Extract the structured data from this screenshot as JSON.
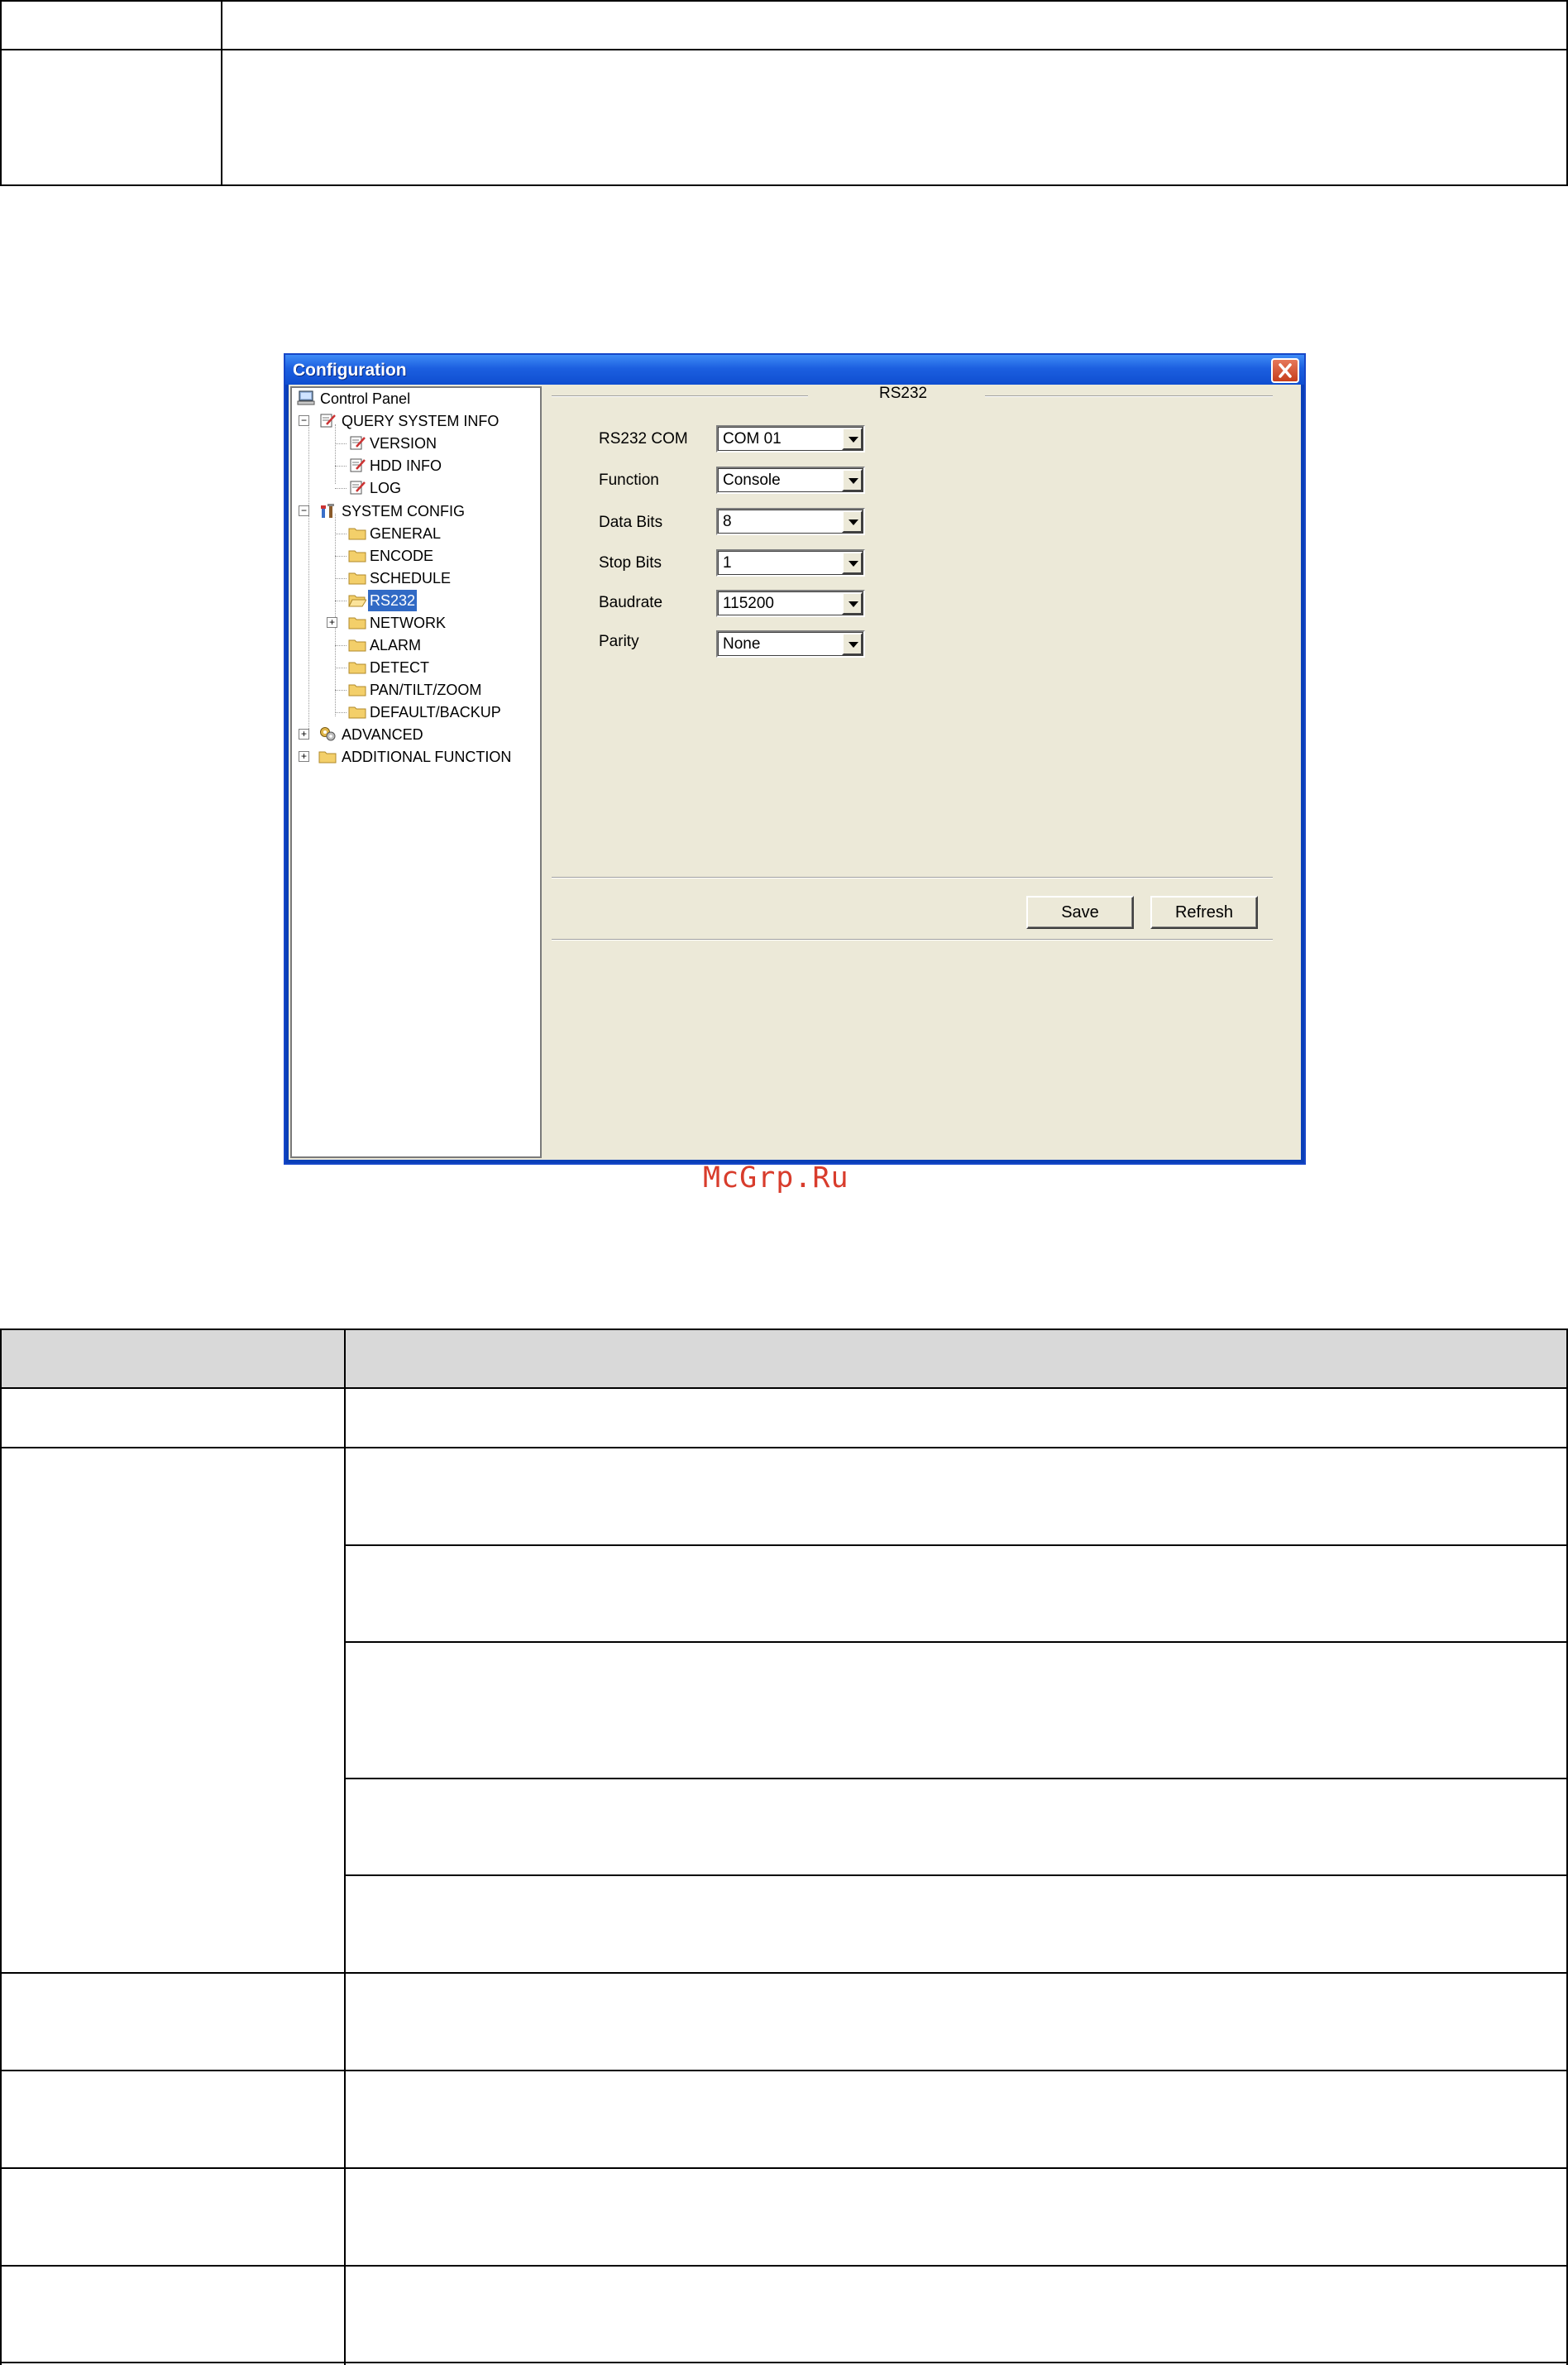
{
  "window": {
    "title": "Configuration",
    "close_icon": "close-icon"
  },
  "tree": {
    "root": {
      "label": "Control Panel",
      "icon": "computer-icon"
    },
    "items": [
      {
        "label": "QUERY SYSTEM INFO",
        "icon": "notepad-icon",
        "expander": "−"
      },
      {
        "label": "VERSION",
        "icon": "notepad-icon"
      },
      {
        "label": "HDD INFO",
        "icon": "notepad-icon"
      },
      {
        "label": "LOG",
        "icon": "notepad-icon"
      },
      {
        "label": "SYSTEM CONFIG",
        "icon": "tools-icon",
        "expander": "−"
      },
      {
        "label": "GENERAL",
        "icon": "folder-icon"
      },
      {
        "label": "ENCODE",
        "icon": "folder-icon"
      },
      {
        "label": "SCHEDULE",
        "icon": "folder-icon"
      },
      {
        "label": "RS232",
        "icon": "folder-open-icon",
        "selected": true
      },
      {
        "label": "NETWORK",
        "icon": "folder-icon",
        "expander": "+"
      },
      {
        "label": "ALARM",
        "icon": "folder-icon"
      },
      {
        "label": "DETECT",
        "icon": "folder-icon"
      },
      {
        "label": "PAN/TILT/ZOOM",
        "icon": "folder-icon"
      },
      {
        "label": "DEFAULT/BACKUP",
        "icon": "folder-icon"
      },
      {
        "label": "ADVANCED",
        "icon": "gears-icon",
        "expander": "+"
      },
      {
        "label": "ADDITIONAL FUNCTION",
        "icon": "folder-icon",
        "expander": "+"
      }
    ]
  },
  "panel": {
    "section_title": "RS232",
    "fields": [
      {
        "label": "RS232 COM",
        "value": "COM 01"
      },
      {
        "label": "Function",
        "value": "Console"
      },
      {
        "label": "Data Bits",
        "value": "8"
      },
      {
        "label": "Stop Bits",
        "value": "1"
      },
      {
        "label": "Baudrate",
        "value": "115200"
      },
      {
        "label": "Parity",
        "value": "None"
      }
    ],
    "save_label": "Save",
    "refresh_label": "Refresh"
  },
  "watermark": "McGrp.Ru",
  "colors": {
    "title_bar": "#1c5fe0",
    "selection": "#316ac5",
    "dialog_bg": "#ece9d8",
    "watermark": "#d83c2c",
    "table_header": "#d9d9d9"
  }
}
